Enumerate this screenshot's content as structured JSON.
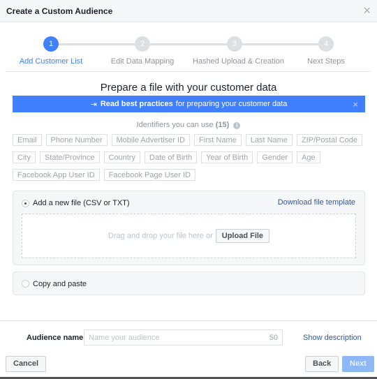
{
  "header": {
    "title": "Create a Custom Audience",
    "close_icon": "×"
  },
  "steps": [
    {
      "num": "1",
      "label": "Add Customer List",
      "active": true
    },
    {
      "num": "2",
      "label": "Edit Data Mapping"
    },
    {
      "num": "3",
      "label": "Hashed Upload & Creation"
    },
    {
      "num": "4",
      "label": "Next Steps"
    }
  ],
  "heading": "Prepare a file with your customer data",
  "banner": {
    "bold": "Read best practices",
    "text": "for preparing your customer data",
    "close": "×",
    "color": "#4080ff"
  },
  "identifiers": {
    "label": "Identifiers you can use",
    "count": "(15)",
    "info": "i",
    "items": [
      "Email",
      "Phone Number",
      "Mobile Advertiser ID",
      "First Name",
      "Last Name",
      "ZIP/Postal Code",
      "City",
      "State/Province",
      "Country",
      "Date of Birth",
      "Year of Birth",
      "Gender",
      "Age",
      "Facebook App User ID",
      "Facebook Page User ID"
    ]
  },
  "upload": {
    "option_label": "Add a new file (CSV or TXT)",
    "download_link": "Download file template",
    "drop_text": "Drag and drop your file here or",
    "upload_button": "Upload File"
  },
  "paste": {
    "option_label": "Copy and paste"
  },
  "footer": {
    "audience_label": "Audience name",
    "audience_placeholder": "Name your audience",
    "char_limit": "50",
    "show_description": "Show description",
    "cancel": "Cancel",
    "back": "Back",
    "next": "Next"
  }
}
